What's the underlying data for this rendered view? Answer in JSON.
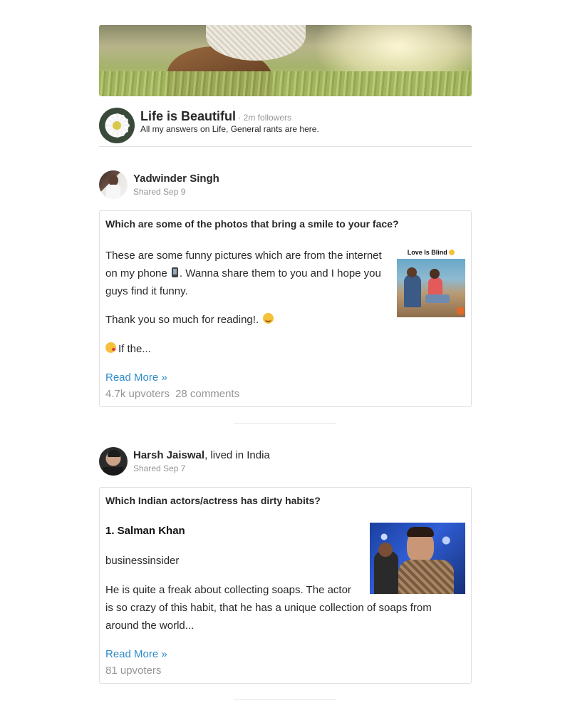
{
  "space": {
    "title": "Life is Beautiful",
    "followers": " · 2m followers",
    "description": "All my answers on Life, General rants are here."
  },
  "posts": [
    {
      "author": "Yadwinder Singh",
      "author_suffix": "",
      "date": "Shared Sep 9",
      "question": "Which are some of the photos that bring a smile to your face?",
      "paragraphs": [
        "These are some funny pictures which are from the internet on my phone",
        ". Wanna share them to you and I hope you guys find it funny.",
        "Thank you so much for reading!.",
        "If the..."
      ],
      "image_caption": "Love Is Blind",
      "read_more": "Read More »",
      "upvoters": "4.7k upvoters",
      "comments": "28 comments"
    },
    {
      "author": "Harsh Jaiswal",
      "author_suffix": ", lived in India",
      "date": "Shared Sep 7",
      "question": "Which Indian actors/actress has dirty habits?",
      "heading": "1. Salman Khan",
      "paragraphs": [
        "businessinsider",
        "He is quite a freak about collecting soaps. The actor is so crazy of this habit, that he has a unique collection of soaps from around the world..."
      ],
      "read_more": "Read More »",
      "upvoters": "81 upvoters"
    }
  ],
  "icons": {
    "phone": "mobile-phone-icon",
    "smile": "smiling-face-icon",
    "kiss": "kissing-face-icon"
  }
}
